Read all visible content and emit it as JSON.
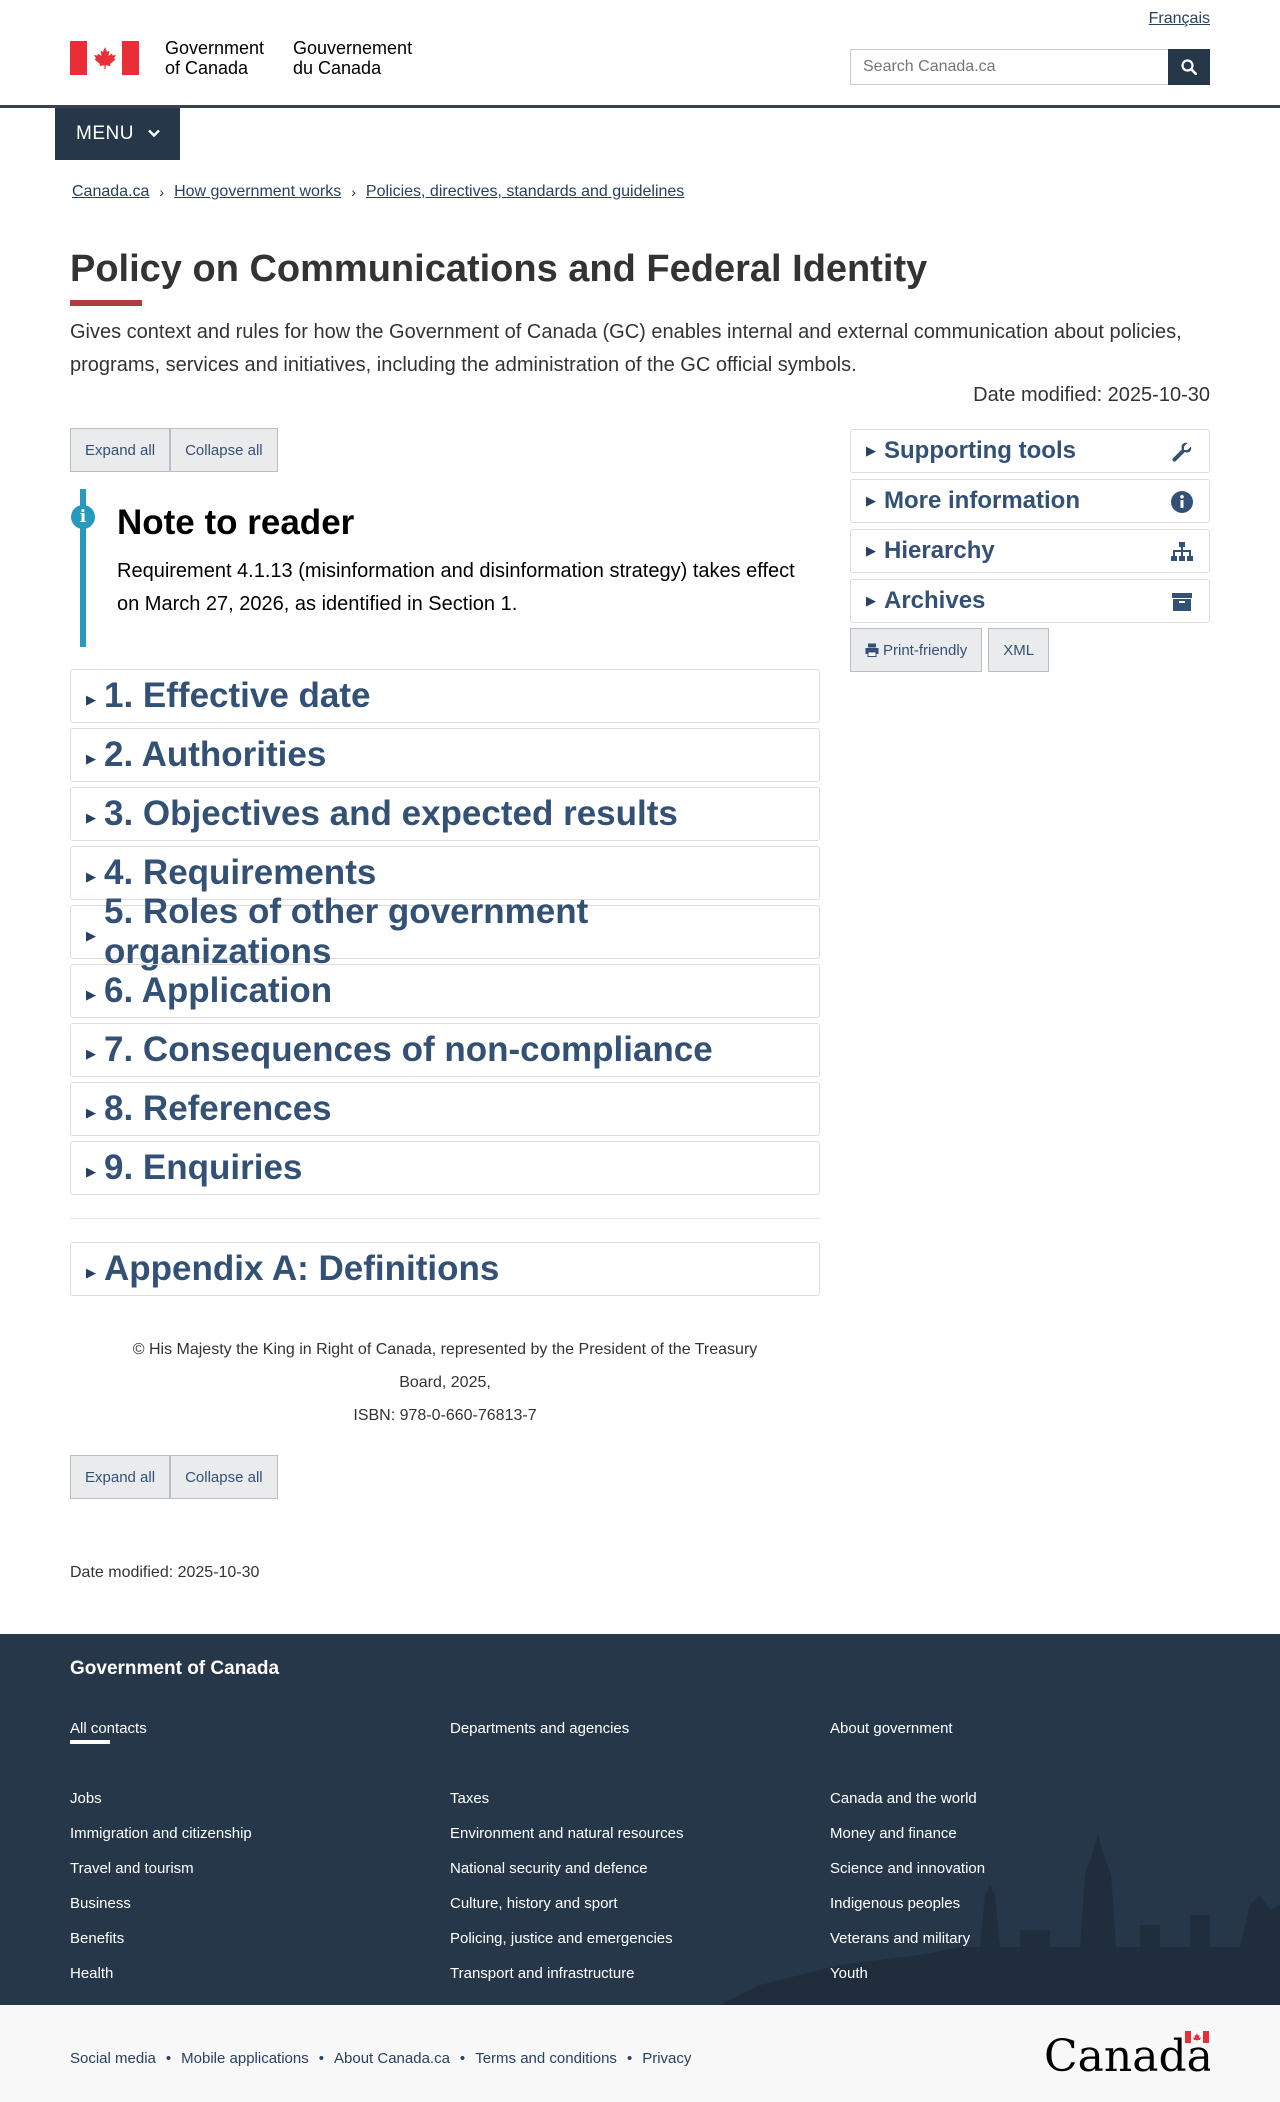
{
  "header": {
    "lang_link": "Français",
    "wordmark_en_line1": "Government",
    "wordmark_en_line2": "of Canada",
    "wordmark_fr_line1": "Gouvernement",
    "wordmark_fr_line2": "du Canada",
    "search_placeholder": "Search Canada.ca",
    "menu_label": "MENU"
  },
  "breadcrumb": [
    "Canada.ca",
    "How government works",
    "Policies, directives, standards and guidelines"
  ],
  "page": {
    "title": "Policy on Communications and Federal Identity",
    "intro": "Gives context and rules for how the Government of Canada (GC) enables internal and external communication about policies, programs, services and initiatives, including the administration of the GC official symbols.",
    "date_modified_top": "Date modified: 2025-10-30",
    "expand_all": "Expand all",
    "collapse_all": "Collapse all"
  },
  "note": {
    "title": "Note to reader",
    "body": "Requirement 4.1.13 (misinformation and disinformation strategy) takes effect on March 27, 2026, as identified in Section 1."
  },
  "sections": [
    "1. Effective date",
    "2. Authorities",
    "3. Objectives and expected results",
    "4. Requirements",
    "5. Roles of other government organizations",
    "6. Application",
    "7. Consequences of non-compliance",
    "8. References",
    "9. Enquiries"
  ],
  "appendix": "Appendix A: Definitions",
  "copyright": {
    "line1": "© His Majesty the King in Right of Canada, represented by the President of the Treasury",
    "line2": "Board, 2025,",
    "isbn": "ISBN: 978-0-660-76813-7"
  },
  "date_modified_bottom": "Date modified: 2025-10-30",
  "sidebar": {
    "items": [
      {
        "label": "Supporting tools",
        "icon": "wrench-icon"
      },
      {
        "label": "More information",
        "icon": "info-icon"
      },
      {
        "label": "Hierarchy",
        "icon": "sitemap-icon"
      },
      {
        "label": "Archives",
        "icon": "archive-icon"
      }
    ],
    "print_label": "Print-friendly",
    "xml_label": "XML"
  },
  "footer": {
    "title": "Government of Canada",
    "top_links": [
      "All contacts",
      "Departments and agencies",
      "About government"
    ],
    "col1": [
      "Jobs",
      "Immigration and citizenship",
      "Travel and tourism",
      "Business",
      "Benefits",
      "Health"
    ],
    "col2": [
      "Taxes",
      "Environment and natural resources",
      "National security and defence",
      "Culture, history and sport",
      "Policing, justice and emergencies",
      "Transport and infrastructure"
    ],
    "col3": [
      "Canada and the world",
      "Money and finance",
      "Science and innovation",
      "Indigenous peoples",
      "Veterans and military",
      "Youth"
    ],
    "bottom_links": [
      "Social media",
      "Mobile applications",
      "About Canada.ca",
      "Terms and conditions",
      "Privacy"
    ],
    "wordmark": "Canada"
  },
  "colors": {
    "header_dark": "#26374a",
    "link": "#284162",
    "accent_red": "#af3c43",
    "note_blue": "#269abc",
    "heading_blue": "#335075"
  }
}
